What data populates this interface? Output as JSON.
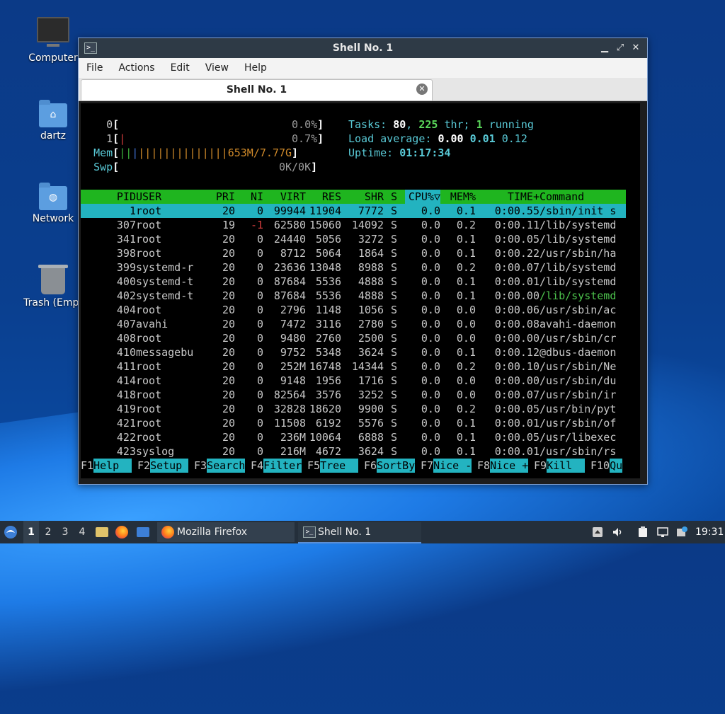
{
  "desktop": {
    "icons": [
      {
        "label": "Computer"
      },
      {
        "label": "dartz"
      },
      {
        "label": "Network"
      },
      {
        "label": "Trash (Empt"
      }
    ]
  },
  "window": {
    "title": "Shell No. 1",
    "menu": [
      "File",
      "Actions",
      "Edit",
      "View",
      "Help"
    ],
    "tab_label": "Shell No. 1"
  },
  "htop": {
    "cpu0": {
      "label": "0",
      "value": "0.0%"
    },
    "cpu1": {
      "label": "1",
      "value": "0.7%"
    },
    "mem": {
      "label": "Mem",
      "value": "653M/7.77G"
    },
    "swp": {
      "label": "Swp",
      "value": "0K/0K"
    },
    "tasks_label": "Tasks:",
    "tasks_total": "80",
    "tasks_threads": "225",
    "thr_label": "thr;",
    "tasks_running": "1",
    "running_label": "running",
    "load_label": "Load average:",
    "load_1": "0.00",
    "load_5": "0.01",
    "load_15": "0.12",
    "uptime_label": "Uptime:",
    "uptime": "01:17:34",
    "columns": [
      "PID",
      "USER",
      "PRI",
      "NI",
      "VIRT",
      "RES",
      "SHR",
      "S",
      "CPU%▽",
      "MEM%",
      "TIME+",
      "Command"
    ],
    "processes": [
      {
        "pid": "1",
        "user": "root",
        "pri": "20",
        "ni": "0",
        "virt": "99944",
        "res": "11904",
        "shr": "7772",
        "s": "S",
        "cpu": "0.0",
        "mem": "0.1",
        "time": "0:00.55",
        "cmd": "/sbin/init s",
        "selected": true
      },
      {
        "pid": "307",
        "user": "root",
        "pri": "19",
        "ni": "-1",
        "virt": "62580",
        "res": "15060",
        "shr": "14092",
        "s": "S",
        "cpu": "0.0",
        "mem": "0.2",
        "time": "0:00.11",
        "cmd": "/lib/systemd"
      },
      {
        "pid": "341",
        "user": "root",
        "pri": "20",
        "ni": "0",
        "virt": "24440",
        "res": "5056",
        "shr": "3272",
        "s": "S",
        "cpu": "0.0",
        "mem": "0.1",
        "time": "0:00.05",
        "cmd": "/lib/systemd"
      },
      {
        "pid": "398",
        "user": "root",
        "pri": "20",
        "ni": "0",
        "virt": "8712",
        "res": "5064",
        "shr": "1864",
        "s": "S",
        "cpu": "0.0",
        "mem": "0.1",
        "time": "0:00.22",
        "cmd": "/usr/sbin/ha"
      },
      {
        "pid": "399",
        "user": "systemd-r",
        "pri": "20",
        "ni": "0",
        "virt": "23636",
        "res": "13048",
        "shr": "8988",
        "s": "S",
        "cpu": "0.0",
        "mem": "0.2",
        "time": "0:00.07",
        "cmd": "/lib/systemd"
      },
      {
        "pid": "400",
        "user": "systemd-t",
        "pri": "20",
        "ni": "0",
        "virt": "87684",
        "res": "5536",
        "shr": "4888",
        "s": "S",
        "cpu": "0.0",
        "mem": "0.1",
        "time": "0:00.01",
        "cmd": "/lib/systemd"
      },
      {
        "pid": "402",
        "user": "systemd-t",
        "pri": "20",
        "ni": "0",
        "virt": "87684",
        "res": "5536",
        "shr": "4888",
        "s": "S",
        "cpu": "0.0",
        "mem": "0.1",
        "time": "0:00.00",
        "cmd": "/lib/systemd",
        "thread": true
      },
      {
        "pid": "404",
        "user": "root",
        "pri": "20",
        "ni": "0",
        "virt": "2796",
        "res": "1148",
        "shr": "1056",
        "s": "S",
        "cpu": "0.0",
        "mem": "0.0",
        "time": "0:00.06",
        "cmd": "/usr/sbin/ac"
      },
      {
        "pid": "407",
        "user": "avahi",
        "pri": "20",
        "ni": "0",
        "virt": "7472",
        "res": "3116",
        "shr": "2780",
        "s": "S",
        "cpu": "0.0",
        "mem": "0.0",
        "time": "0:00.08",
        "cmd": "avahi-daemon"
      },
      {
        "pid": "408",
        "user": "root",
        "pri": "20",
        "ni": "0",
        "virt": "9480",
        "res": "2760",
        "shr": "2500",
        "s": "S",
        "cpu": "0.0",
        "mem": "0.0",
        "time": "0:00.00",
        "cmd": "/usr/sbin/cr"
      },
      {
        "pid": "410",
        "user": "messagebu",
        "pri": "20",
        "ni": "0",
        "virt": "9752",
        "res": "5348",
        "shr": "3624",
        "s": "S",
        "cpu": "0.0",
        "mem": "0.1",
        "time": "0:00.12",
        "cmd": "@dbus-daemon"
      },
      {
        "pid": "411",
        "user": "root",
        "pri": "20",
        "ni": "0",
        "virt": "252M",
        "res": "16748",
        "shr": "14344",
        "s": "S",
        "cpu": "0.0",
        "mem": "0.2",
        "time": "0:00.10",
        "cmd": "/usr/sbin/Ne"
      },
      {
        "pid": "414",
        "user": "root",
        "pri": "20",
        "ni": "0",
        "virt": "9148",
        "res": "1956",
        "shr": "1716",
        "s": "S",
        "cpu": "0.0",
        "mem": "0.0",
        "time": "0:00.00",
        "cmd": "/usr/sbin/du"
      },
      {
        "pid": "418",
        "user": "root",
        "pri": "20",
        "ni": "0",
        "virt": "82564",
        "res": "3576",
        "shr": "3252",
        "s": "S",
        "cpu": "0.0",
        "mem": "0.0",
        "time": "0:00.07",
        "cmd": "/usr/sbin/ir"
      },
      {
        "pid": "419",
        "user": "root",
        "pri": "20",
        "ni": "0",
        "virt": "32828",
        "res": "18620",
        "shr": "9900",
        "s": "S",
        "cpu": "0.0",
        "mem": "0.2",
        "time": "0:00.05",
        "cmd": "/usr/bin/pyt"
      },
      {
        "pid": "421",
        "user": "root",
        "pri": "20",
        "ni": "0",
        "virt": "11508",
        "res": "6192",
        "shr": "5576",
        "s": "S",
        "cpu": "0.0",
        "mem": "0.1",
        "time": "0:00.01",
        "cmd": "/usr/sbin/of"
      },
      {
        "pid": "422",
        "user": "root",
        "pri": "20",
        "ni": "0",
        "virt": "236M",
        "res": "10064",
        "shr": "6888",
        "s": "S",
        "cpu": "0.0",
        "mem": "0.1",
        "time": "0:00.05",
        "cmd": "/usr/libexec"
      },
      {
        "pid": "423",
        "user": "syslog",
        "pri": "20",
        "ni": "0",
        "virt": "216M",
        "res": "4672",
        "shr": "3624",
        "s": "S",
        "cpu": "0.0",
        "mem": "0.1",
        "time": "0:00.01",
        "cmd": "/usr/sbin/rs"
      }
    ],
    "fkeys": [
      {
        "key": "F1",
        "action": "Help  "
      },
      {
        "key": "F2",
        "action": "Setup "
      },
      {
        "key": "F3",
        "action": "Search"
      },
      {
        "key": "F4",
        "action": "Filter"
      },
      {
        "key": "F5",
        "action": "Tree  "
      },
      {
        "key": "F6",
        "action": "SortBy"
      },
      {
        "key": "F7",
        "action": "Nice -"
      },
      {
        "key": "F8",
        "action": "Nice +"
      },
      {
        "key": "F9",
        "action": "Kill  "
      },
      {
        "key": "F10",
        "action": "Qu"
      }
    ]
  },
  "taskbar": {
    "workspaces": [
      "1",
      "2",
      "3",
      "4"
    ],
    "tasks": [
      {
        "label": "Mozilla Firefox"
      },
      {
        "label": "Shell No. 1"
      }
    ],
    "clock": "19:31"
  },
  "colors": {
    "header_green": "#1fb51f",
    "selection_cyan": "#23b3c0",
    "taskbar": "#242f3b"
  }
}
